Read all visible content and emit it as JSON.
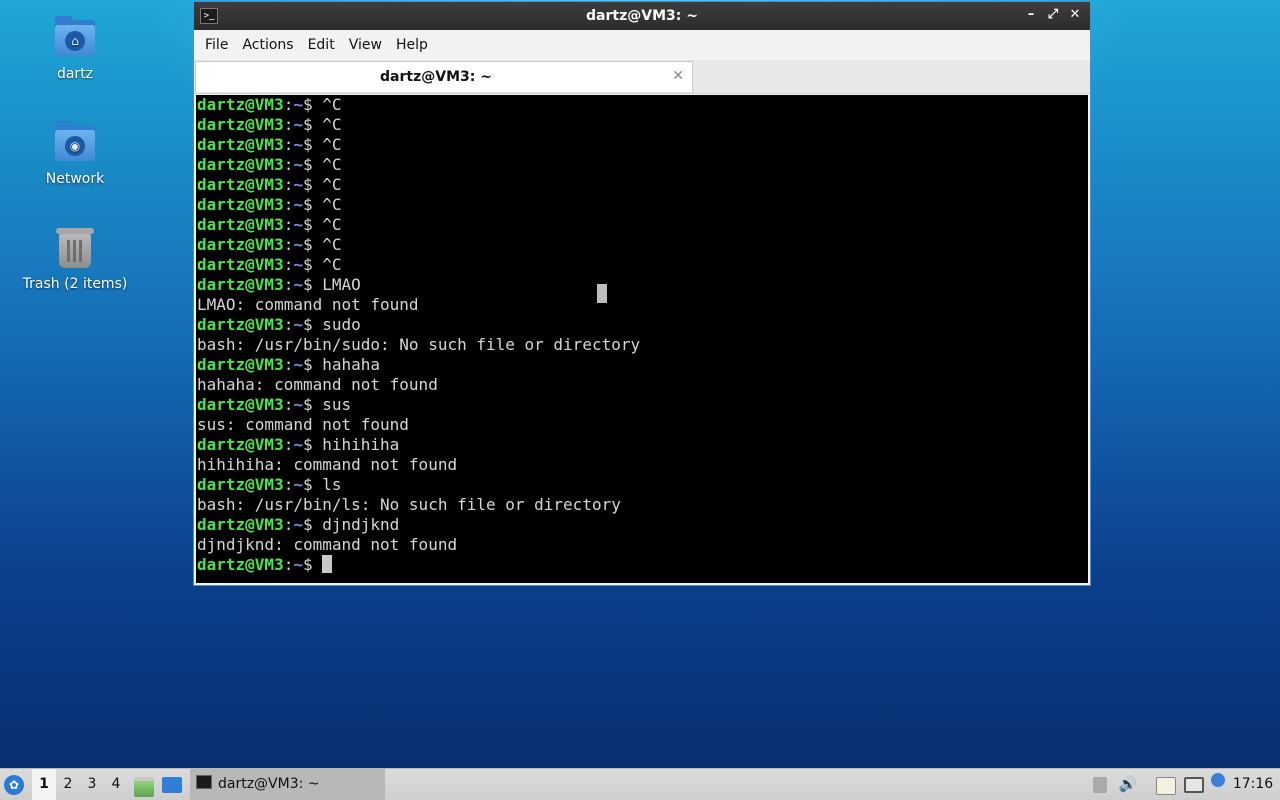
{
  "desktop": {
    "icons": [
      {
        "label": "dartz",
        "glyph": "⌂"
      },
      {
        "label": "Network",
        "glyph": "◉"
      },
      {
        "label": "Trash (2 items)"
      }
    ]
  },
  "window": {
    "title": "dartz@VM3: ~",
    "controls": {
      "minimize": "–",
      "maximize": "⤢",
      "close": "✕"
    },
    "menu": [
      "File",
      "Actions",
      "Edit",
      "View",
      "Help"
    ],
    "tab": {
      "title": "dartz@VM3: ~",
      "close": "✕"
    }
  },
  "terminal": {
    "prompt_user": "dartz@VM3",
    "prompt_sep": ":",
    "prompt_path": "~",
    "prompt_end": "$ ",
    "lines": [
      {
        "kind": "cmd",
        "text": "^C"
      },
      {
        "kind": "cmd",
        "text": "^C"
      },
      {
        "kind": "cmd",
        "text": "^C"
      },
      {
        "kind": "cmd",
        "text": "^C"
      },
      {
        "kind": "cmd",
        "text": "^C"
      },
      {
        "kind": "cmd",
        "text": "^C"
      },
      {
        "kind": "cmd",
        "text": "^C"
      },
      {
        "kind": "cmd",
        "text": "^C"
      },
      {
        "kind": "cmd",
        "text": "^C"
      },
      {
        "kind": "cmd",
        "text": "LMAO"
      },
      {
        "kind": "out",
        "text": "LMAO: command not found"
      },
      {
        "kind": "cmd",
        "text": "sudo"
      },
      {
        "kind": "out",
        "text": "bash: /usr/bin/sudo: No such file or directory"
      },
      {
        "kind": "cmd",
        "text": "hahaha"
      },
      {
        "kind": "out",
        "text": "hahaha: command not found"
      },
      {
        "kind": "cmd",
        "text": "sus"
      },
      {
        "kind": "out",
        "text": "sus: command not found"
      },
      {
        "kind": "cmd",
        "text": "hihihiha"
      },
      {
        "kind": "out",
        "text": "hihihiha: command not found"
      },
      {
        "kind": "cmd",
        "text": "ls"
      },
      {
        "kind": "out",
        "text": "bash: /usr/bin/ls: No such file or directory"
      },
      {
        "kind": "cmd",
        "text": "djndjknd"
      },
      {
        "kind": "out",
        "text": "djndjknd: command not found"
      },
      {
        "kind": "cmd",
        "text": ""
      }
    ],
    "colors": {
      "user": "#4ee34b",
      "path": "#6f8fe6",
      "text": "#d6d6d6",
      "background": "#000000"
    }
  },
  "taskbar": {
    "start_glyph": "✿",
    "workspaces": [
      "1",
      "2",
      "3",
      "4"
    ],
    "active_workspace": "1",
    "task_title": "dartz@VM3: ~",
    "tray_icons": [
      "tray-up-icon",
      "volume-icon",
      "clipboard-icon",
      "network-icon",
      "notification-icon"
    ],
    "volume_glyph": "🔊",
    "clock": "17:16"
  }
}
